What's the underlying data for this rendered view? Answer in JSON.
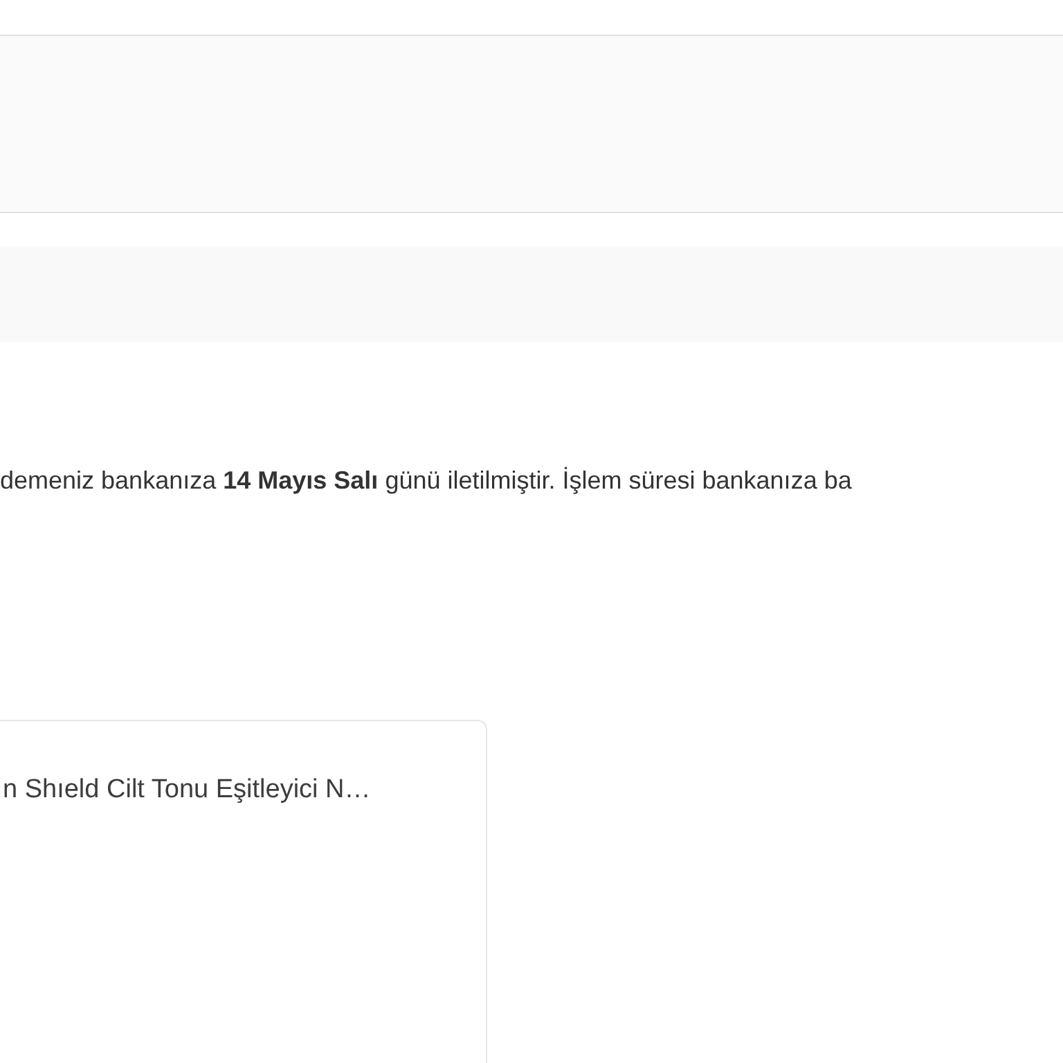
{
  "payment_notice": "demeniz bankanıza **14 Mayıs Salı** günü iletilmiştir. İşlem süresi bankanıza ba",
  "product_card": {
    "title": "n Shıeld Cilt Tonu Eşitleyici N…"
  }
}
